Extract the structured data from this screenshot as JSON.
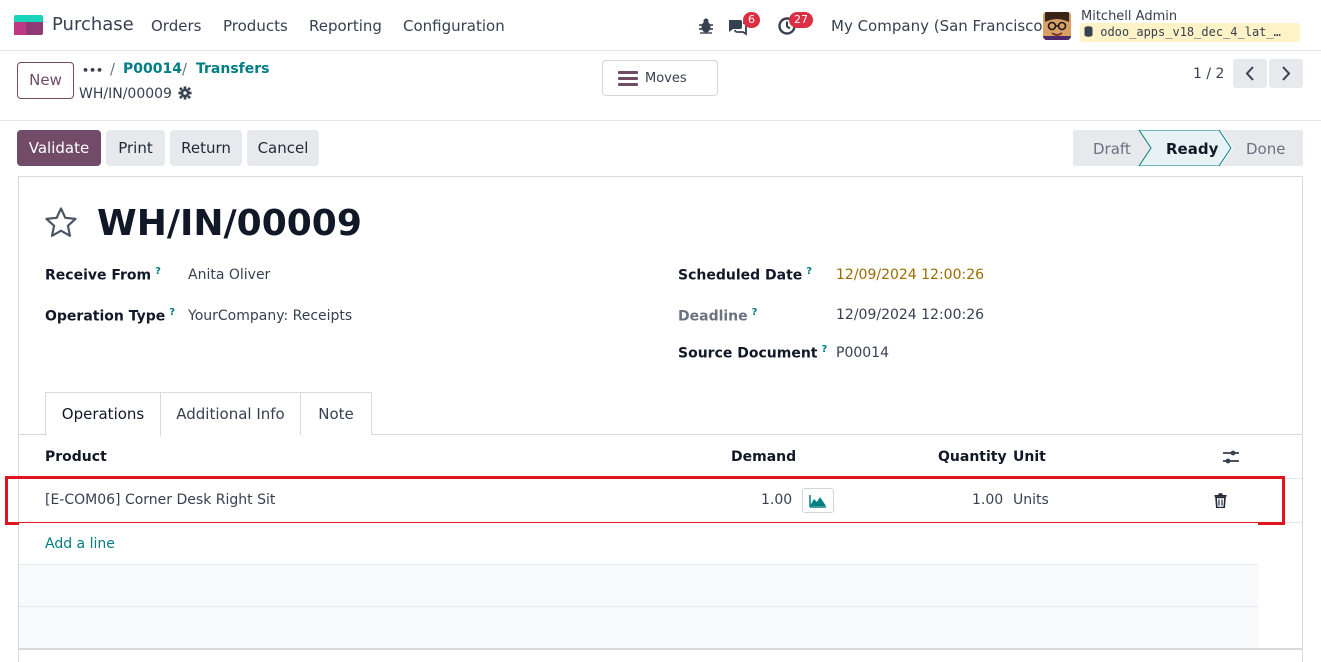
{
  "navbar": {
    "app_name": "Purchase",
    "menu": [
      "Orders",
      "Products",
      "Reporting",
      "Configuration"
    ],
    "chat_count": "6",
    "activity_count": "27",
    "company": "My Company (San Francisco)",
    "user_name": "Mitchell Admin",
    "db_name": "odoo_apps_v18_dec_4_lat_…"
  },
  "control_panel": {
    "new_label": "New",
    "breadcrumb_dots": "•••",
    "breadcrumbs": [
      "P00014",
      "Transfers"
    ],
    "record_name": "WH/IN/00009",
    "moves_label": "Moves",
    "pager": "1 / 2"
  },
  "actions": {
    "validate": "Validate",
    "print": "Print",
    "return": "Return",
    "cancel": "Cancel"
  },
  "status": {
    "stages": [
      "Draft",
      "Ready",
      "Done"
    ],
    "current": "Ready"
  },
  "form": {
    "title": "WH/IN/00009",
    "receive_from_label": "Receive From",
    "receive_from": "Anita Oliver",
    "operation_type_label": "Operation Type",
    "operation_type": "YourCompany: Receipts",
    "scheduled_date_label": "Scheduled Date",
    "scheduled_date": "12/09/2024 12:00:26",
    "deadline_label": "Deadline",
    "deadline": "12/09/2024 12:00:26",
    "source_document_label": "Source Document",
    "source_document": "P00014",
    "help_mark": "?"
  },
  "tabs": [
    "Operations",
    "Additional Info",
    "Note"
  ],
  "table": {
    "headers": {
      "product": "Product",
      "demand": "Demand",
      "quantity": "Quantity",
      "unit": "Unit"
    },
    "rows": [
      {
        "product": "[E-COM06] Corner Desk Right Sit",
        "demand": "1.00",
        "quantity": "1.00",
        "unit": "Units"
      }
    ],
    "add_line": "Add a line"
  },
  "colors": {
    "brand": "#714b67",
    "link": "#017e84",
    "badge": "#dc2f43",
    "highlight": "#e0141e",
    "warning_date": "#9c6b00"
  }
}
